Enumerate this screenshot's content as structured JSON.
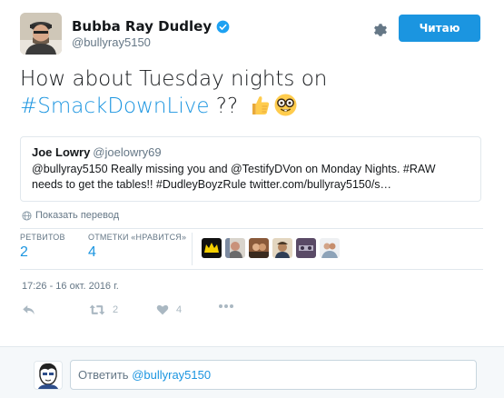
{
  "author": {
    "name": "Bubba Ray Dudley",
    "handle": "@bullyray5150",
    "verified": true
  },
  "header": {
    "follow_label": "Читаю",
    "gear_icon": "gear-icon"
  },
  "tweet": {
    "text_start": "How about Tuesday nights on",
    "hashtag": "#SmackDownLive",
    "text_end": " ??",
    "emojis": [
      "thumbs-up-emoji",
      "nerd-face-emoji"
    ]
  },
  "quote": {
    "name": "Joe Lowry",
    "handle": "@joelowry69",
    "text": "@bullyray5150 Really missing you and @TestifyDVon on Monday Nights. #RAW needs to get the tables!! #DudleyBoyzRule twitter.com/bullyray5150/s…"
  },
  "translate_label": "Показать перевод",
  "stats": {
    "retweets_label": "РЕТВИТОВ",
    "retweets_value": "2",
    "likes_label": "ОТМЕТКИ «НРАВИТСЯ»",
    "likes_value": "4"
  },
  "timestamp": "17:26 - 16 окт. 2016 г.",
  "actions": {
    "retweet_count": "2",
    "like_count": "4"
  },
  "reply": {
    "prefix": "Ответить ",
    "mention": "@bullyray5150"
  },
  "colors": {
    "accent": "#1b95e0",
    "muted": "#657786",
    "icon": "#aab8c2"
  }
}
